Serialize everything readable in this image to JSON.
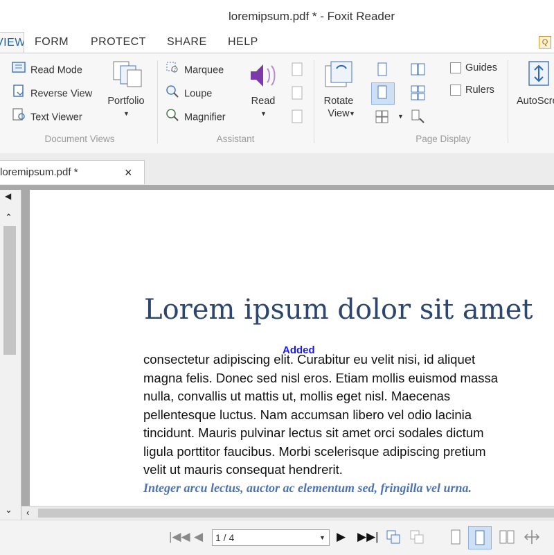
{
  "window": {
    "title": "loremipsum.pdf * - Foxit Reader"
  },
  "ribbon_tabs": [
    {
      "label": "VIEW",
      "active": true
    },
    {
      "label": "FORM"
    },
    {
      "label": "PROTECT"
    },
    {
      "label": "SHARE"
    },
    {
      "label": "HELP"
    }
  ],
  "ribbon": {
    "document_views": {
      "label": "Document Views",
      "items": [
        "Read Mode",
        "Reverse View",
        "Text Viewer"
      ],
      "portfolio": "Portfolio"
    },
    "assistant": {
      "label": "Assistant",
      "items": [
        "Marquee",
        "Loupe",
        "Magnifier"
      ],
      "read": "Read"
    },
    "rotate_view": "Rotate View",
    "page_display": {
      "label": "Page Display",
      "checkboxes": [
        "Guides",
        "Rulers"
      ],
      "autoscroll": "AutoScroll"
    }
  },
  "document_tab": {
    "label": "loremipsum.pdf *",
    "close": "×"
  },
  "document": {
    "heading": "Lorem ipsum dolor sit amet",
    "annotation": "Added",
    "body_lines": [
      "consectetur adipiscing elit. Curabitur eu velit nisi, id aliquet",
      "magna felis. Donec sed nisl eros. Etiam mollis euismod massa",
      "nulla, convallis ut mattis ut, mollis eget nisl. Maecenas",
      "pellentesque luctus. Nam accumsan libero vel odio lacinia",
      "tincidunt. Mauris pulvinar lectus sit amet orci sodales dictum",
      "ligula porttitor faucibus. Morbi scelerisque adipiscing pretium",
      "velit ut mauris consequat hendrerit."
    ],
    "quote": "Integer arcu lectus, auctor ac elementum sed, fringilla vel urna."
  },
  "status_bar": {
    "page_indicator": "1 / 4"
  },
  "colors": {
    "heading": "#2c4670",
    "quote": "#4c74b4",
    "annotation": "#1a1adc",
    "read_icon": "#7b3aa8"
  }
}
